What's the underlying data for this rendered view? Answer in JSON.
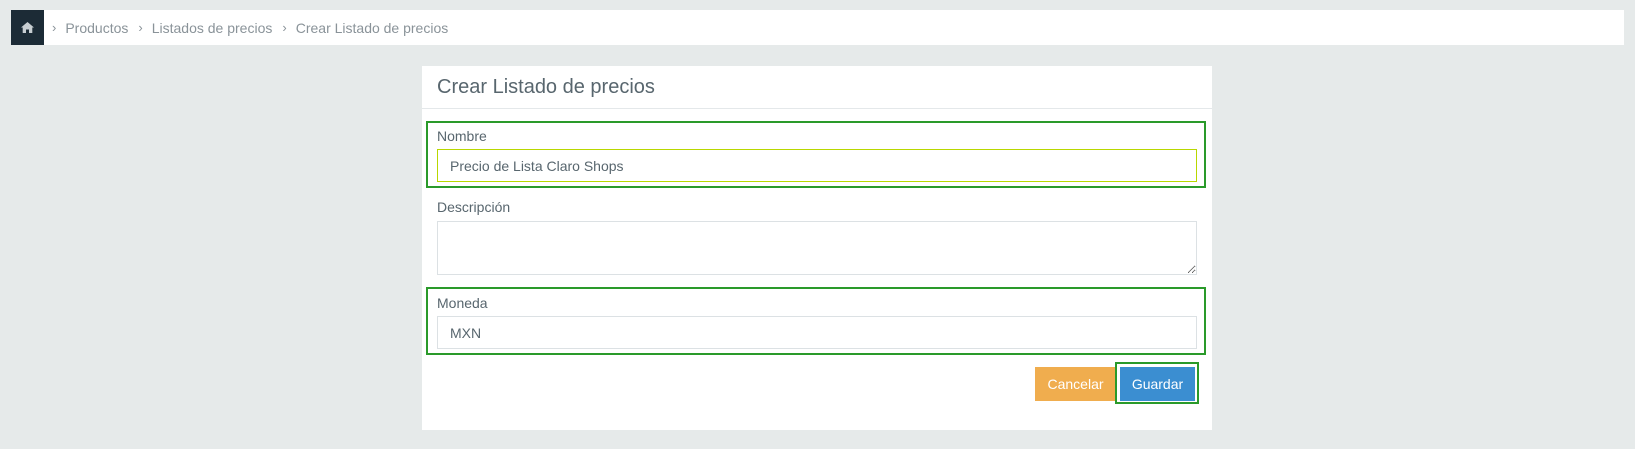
{
  "breadcrumb": {
    "home_icon": "home-icon",
    "items": [
      {
        "label": "Productos"
      },
      {
        "label": "Listados de precios"
      },
      {
        "label": "Crear Listado de precios"
      }
    ],
    "separator": "›"
  },
  "panel": {
    "title": "Crear Listado de precios"
  },
  "form": {
    "nombre": {
      "label": "Nombre",
      "value": "Precio de Lista Claro Shops"
    },
    "descripcion": {
      "label": "Descripción",
      "value": ""
    },
    "moneda": {
      "label": "Moneda",
      "value": "MXN"
    }
  },
  "actions": {
    "cancel_label": "Cancelar",
    "save_label": "Guardar"
  },
  "colors": {
    "home_bg": "#1c2b36",
    "cancel": "#f0ad4e",
    "save": "#3b8ed1",
    "highlight": "#2a9a2a"
  }
}
